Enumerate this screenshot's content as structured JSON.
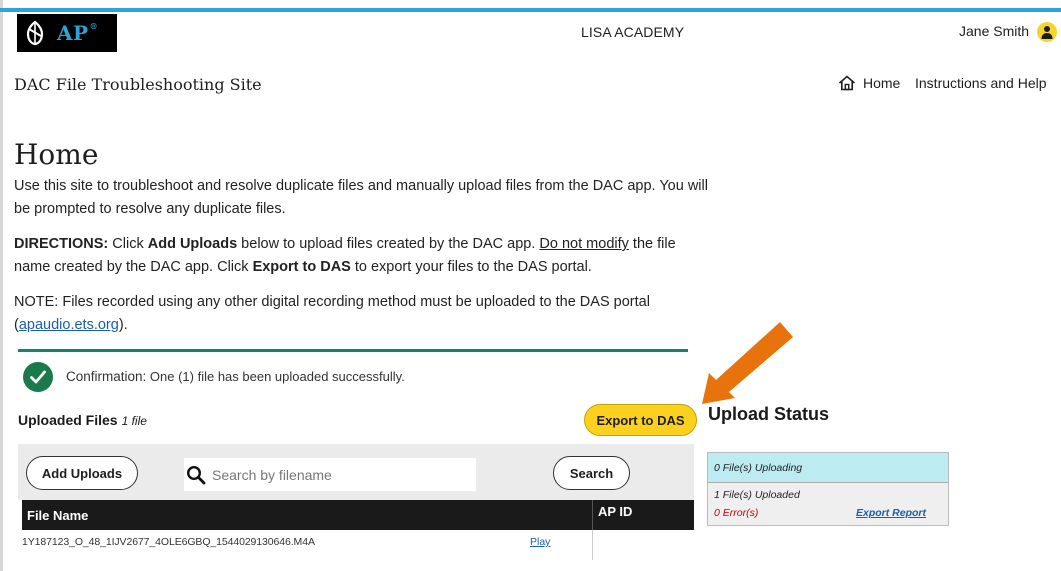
{
  "header": {
    "logo_text": "AP",
    "logo_mark": "®",
    "school_name": "LISA ACADEMY",
    "user_name": "Jane Smith"
  },
  "nav": {
    "site_title": "DAC File Troubleshooting Site",
    "home_label": "Home",
    "help_label": "Instructions and Help"
  },
  "main": {
    "page_title": "Home",
    "intro": "Use this site to troubleshoot and resolve duplicate files and manually upload files from the DAC app. You will be prompted to resolve any duplicate files.",
    "directions": {
      "label": "DIRECTIONS:",
      "t1": " Click ",
      "add_uploads": "Add Uploads",
      "t2": " below to upload files created by the DAC app. ",
      "do_not_modify": "Do not modify",
      "t3": " the file name created by the DAC app. Click ",
      "export_to_das": "Export to DAS",
      "t4": " to export your files to the DAS portal."
    },
    "note": {
      "t1": "NOTE: Files recorded using any other digital recording method must be uploaded to the DAS portal (",
      "link": "apaudio.ets.org",
      "t2": ")."
    }
  },
  "confirmation": {
    "label": "Confirmation:",
    "message": " One (1) file has been uploaded successfully."
  },
  "uploads": {
    "title": "Uploaded Files",
    "count": "1 file",
    "export_button": "Export to DAS",
    "add_button": "Add Uploads",
    "search_placeholder": "Search by filename",
    "search_button": "Search",
    "columns": [
      "File Name",
      "AP ID"
    ],
    "rows": [
      {
        "file_name": "1Y187123_O_48_1IJV2677_4OLE6GBQ_1544029130646.M4A",
        "action": "Play",
        "ap_id": ""
      }
    ]
  },
  "upload_status": {
    "title": "Upload Status",
    "uploading": "0 File(s) Uploading",
    "uploaded": "1 File(s) Uploaded",
    "errors": "0 Error(s)",
    "export_report": "Export Report"
  },
  "colors": {
    "accent_blue": "#2ea3d6",
    "button_yellow": "#fcd01f",
    "success_green": "#1b7a4a",
    "arrow_orange": "#e8730c",
    "error_red": "#c20000"
  },
  "icons": [
    "ap-logo-icon",
    "user-avatar-icon",
    "home-icon",
    "check-icon",
    "search-icon",
    "arrow-icon"
  ]
}
